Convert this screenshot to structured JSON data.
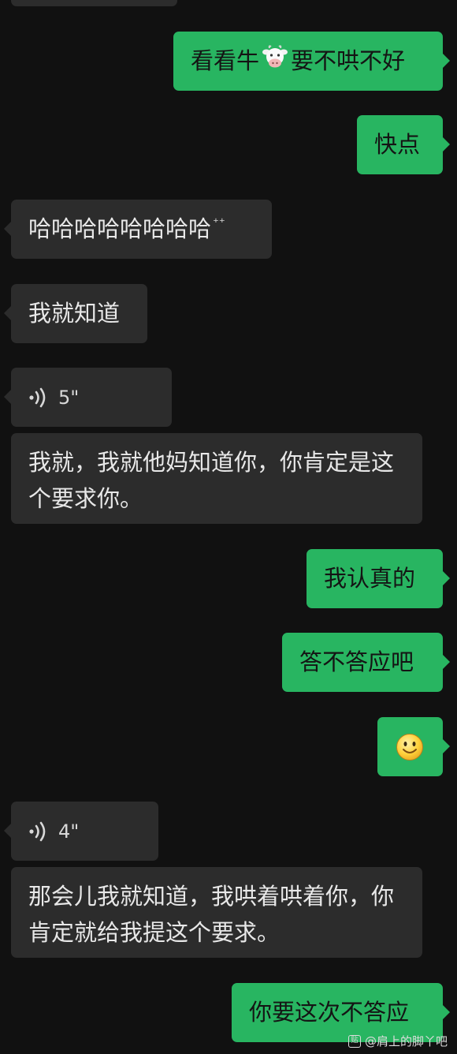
{
  "messages": [
    {
      "text": "看看牛",
      "suffix": "要不哄不好",
      "emoji": "cow-face"
    },
    {
      "text": "快点"
    },
    {
      "text": "哈哈哈哈哈哈哈哈"
    },
    {
      "text": "我就知道"
    },
    {
      "voice_duration": "5\""
    },
    {
      "text": "我就，我就他妈知道你，你肯定是这个要求你。"
    },
    {
      "text": "我认真的"
    },
    {
      "text": "答不答应吧"
    },
    {
      "emoji": "smiling-face"
    },
    {
      "voice_duration": "4\""
    },
    {
      "text": "那会儿我就知道，我哄着哄着你，你肯定就给我提这个要求。"
    },
    {
      "text": "你要这次不答应"
    }
  ],
  "watermark": {
    "text": "@肩上的脚丫吧"
  },
  "colors": {
    "background": "#111111",
    "incoming_bubble": "#2c2c2c",
    "outgoing_bubble": "#28b561"
  }
}
